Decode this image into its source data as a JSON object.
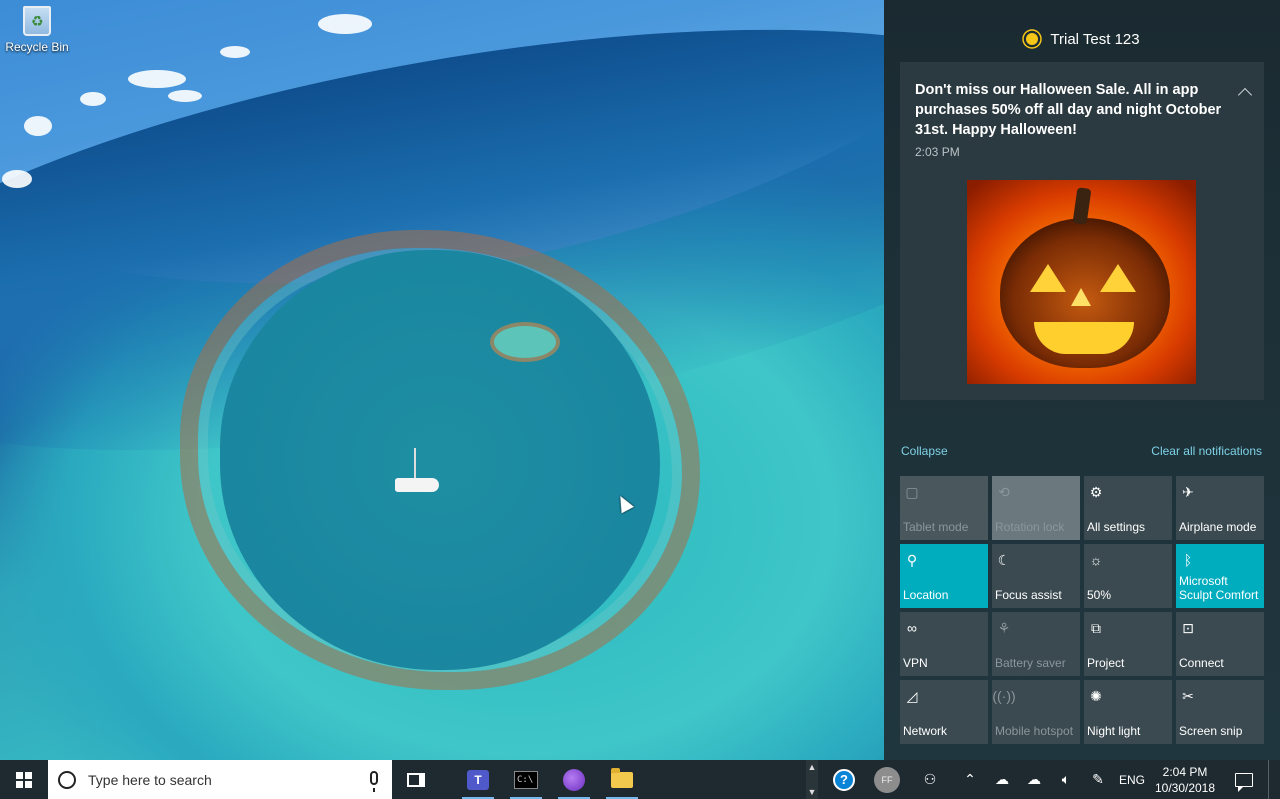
{
  "desktop": {
    "recycle_bin_label": "Recycle Bin"
  },
  "action_center": {
    "app_name": "Trial Test 123",
    "notification": {
      "title": "Don't miss our Halloween Sale. All in app purchases 50% off all day and night October 31st. Happy Halloween!",
      "time": "2:03 PM"
    },
    "collapse_label": "Collapse",
    "clear_all_label": "Clear all notifications",
    "quick_actions": [
      {
        "label": "Tablet mode",
        "icon": "tablet-icon",
        "state": "disabled"
      },
      {
        "label": "Rotation lock",
        "icon": "rotation-lock-icon",
        "state": "disabled-light"
      },
      {
        "label": "All settings",
        "icon": "gear-icon",
        "state": "normal"
      },
      {
        "label": "Airplane mode",
        "icon": "airplane-icon",
        "state": "normal"
      },
      {
        "label": "Location",
        "icon": "location-icon",
        "state": "active"
      },
      {
        "label": "Focus assist",
        "icon": "moon-icon",
        "state": "normal"
      },
      {
        "label": "50%",
        "icon": "brightness-icon",
        "state": "normal"
      },
      {
        "label": "Microsoft Sculpt Comfort",
        "icon": "bluetooth-icon",
        "state": "active"
      },
      {
        "label": "VPN",
        "icon": "vpn-icon",
        "state": "normal"
      },
      {
        "label": "Battery saver",
        "icon": "battery-saver-icon",
        "state": "disabled"
      },
      {
        "label": "Project",
        "icon": "project-icon",
        "state": "normal"
      },
      {
        "label": "Connect",
        "icon": "connect-icon",
        "state": "normal"
      },
      {
        "label": "Network",
        "icon": "network-icon",
        "state": "normal"
      },
      {
        "label": "Mobile hotspot",
        "icon": "hotspot-icon",
        "state": "disabled"
      },
      {
        "label": "Night light",
        "icon": "night-light-icon",
        "state": "normal"
      },
      {
        "label": "Screen snip",
        "icon": "screen-snip-icon",
        "state": "normal"
      }
    ]
  },
  "taskbar": {
    "search_placeholder": "Type here to search",
    "avatar_initials": "FF",
    "language": "ENG",
    "time": "2:04 PM",
    "date": "10/30/2018",
    "colors": {
      "background": "#1f2a30",
      "accent": "#00adbf"
    }
  }
}
